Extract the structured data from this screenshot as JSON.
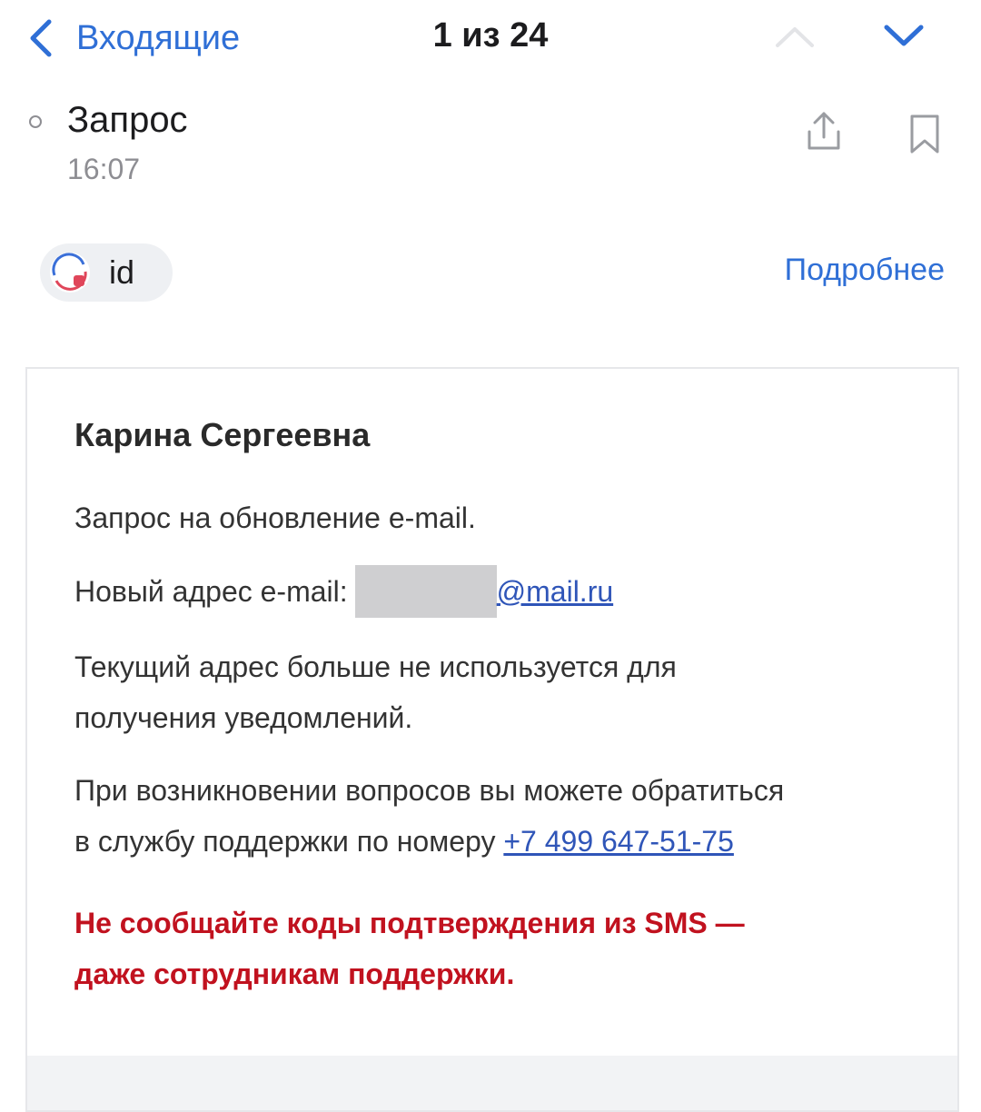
{
  "nav": {
    "back_label": "Входящие",
    "counter": "1 из 24"
  },
  "message": {
    "subject": "Запрос",
    "time": "16:07",
    "sender_name": "id",
    "more_link": "Подробнее"
  },
  "body": {
    "greeting": "Карина Сергеевна",
    "line1": "Запрос на обновление e-mail.",
    "new_email_label": "Новый адрес e-mail:",
    "email_domain": "@mail.ru",
    "line3a": "Текущий адрес больше не используется для",
    "line3b": "получения уведомлений.",
    "line4a": "При возникновении вопросов вы можете обратиться",
    "line4b": "в службу поддержки по номеру",
    "phone": "+7 499 647-51-75",
    "warning_a": "Не сообщайте коды подтверждения из SMS —",
    "warning_b": "даже сотрудникам поддержки."
  },
  "colors": {
    "accent": "#2f6fd6",
    "link": "#2f55b8",
    "warning": "#c1121f"
  },
  "icons": [
    "chevron-left-icon",
    "chevron-up-icon",
    "chevron-down-icon",
    "share-icon",
    "bookmark-icon",
    "sender-logo-icon"
  ]
}
